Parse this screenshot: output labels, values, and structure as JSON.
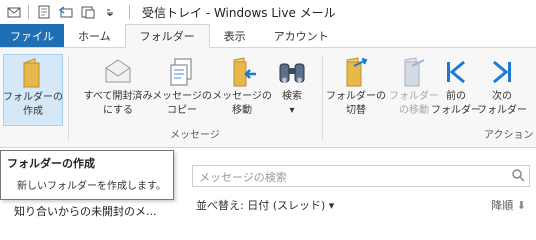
{
  "window": {
    "title": "受信トレイ - Windows Live メール"
  },
  "ribbon_tabs": [
    {
      "label": "ファイル"
    },
    {
      "label": "ホーム"
    },
    {
      "label": "フォルダー"
    },
    {
      "label": "表示"
    },
    {
      "label": "アカウント"
    }
  ],
  "ribbon": {
    "buttons": [
      {
        "label1": "フォルダーの",
        "label2": "作成",
        "icon": "new-folder-icon"
      },
      {
        "label1": "すべて開封済み",
        "label2": "にする",
        "icon": "mark-all-read-icon"
      },
      {
        "label1": "メッセージの",
        "label2": "コピー",
        "icon": "copy-message-icon"
      },
      {
        "label1": "メッセージの",
        "label2": "移動",
        "icon": "move-message-icon"
      },
      {
        "label1": "検索",
        "label2": "▾",
        "icon": "binoculars-icon"
      },
      {
        "label1": "フォルダーの",
        "label2": "切替",
        "icon": "switch-folder-icon"
      },
      {
        "label1": "フォルダー",
        "label2": "の移動",
        "icon": "move-folder-icon"
      },
      {
        "label1": "前の",
        "label2": "フォルダー",
        "icon": "previous-folder-icon"
      },
      {
        "label1": "次の",
        "label2": "フォルダー",
        "icon": "next-folder-icon"
      }
    ],
    "groups": [
      {
        "label": "メッセージ"
      },
      {
        "label": "アクション"
      }
    ]
  },
  "tooltip": {
    "title": "フォルダーの作成",
    "description": "新しいフォルダーを作成します。"
  },
  "search": {
    "placeholder": "メッセージの検索"
  },
  "sort": {
    "label": "並べ替え: 日付 (スレッド)",
    "order": "降順"
  },
  "folder_pane": {
    "item": "知り合いからの未開封のメ..."
  },
  "colors": {
    "file_tab": "#1f6fb6",
    "folder_yellow": "#e8b84a",
    "nav_blue": "#1b7bd3",
    "selected_bg": "#d5e8f7"
  }
}
